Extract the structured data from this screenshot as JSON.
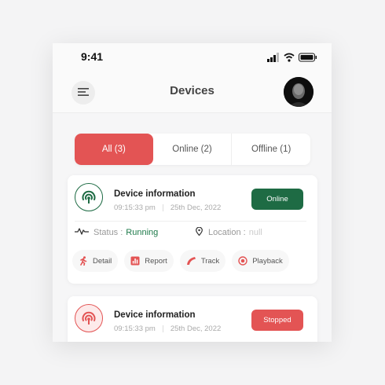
{
  "status_bar": {
    "time": "9:41"
  },
  "header": {
    "title": "Devices"
  },
  "tabs": [
    {
      "label": "All (3)",
      "active": true
    },
    {
      "label": "Online (2)",
      "active": false
    },
    {
      "label": "Offline (1)",
      "active": false
    }
  ],
  "devices": [
    {
      "name": "Device information",
      "time": "09:15:33 pm",
      "date": "25th Dec, 2022",
      "badge": "Online",
      "status_label": "Status :",
      "status_value": "Running",
      "location_label": "Location :",
      "location_value": "null",
      "actions": [
        "Detail",
        "Report",
        "Track",
        "Playback"
      ]
    },
    {
      "name": "Device information",
      "time": "09:15:33 pm",
      "date": "25th Dec, 2022",
      "badge": "Stopped"
    }
  ],
  "colors": {
    "accent_red": "#e35454",
    "online_green": "#1e6b44",
    "running_green": "#1e7a4a"
  },
  "icons": [
    "menu-icon",
    "signal-icon",
    "wifi-icon",
    "battery-icon",
    "device-broadcast-icon",
    "pulse-icon",
    "location-pin-icon",
    "detail-icon",
    "report-icon",
    "track-icon",
    "playback-icon"
  ]
}
